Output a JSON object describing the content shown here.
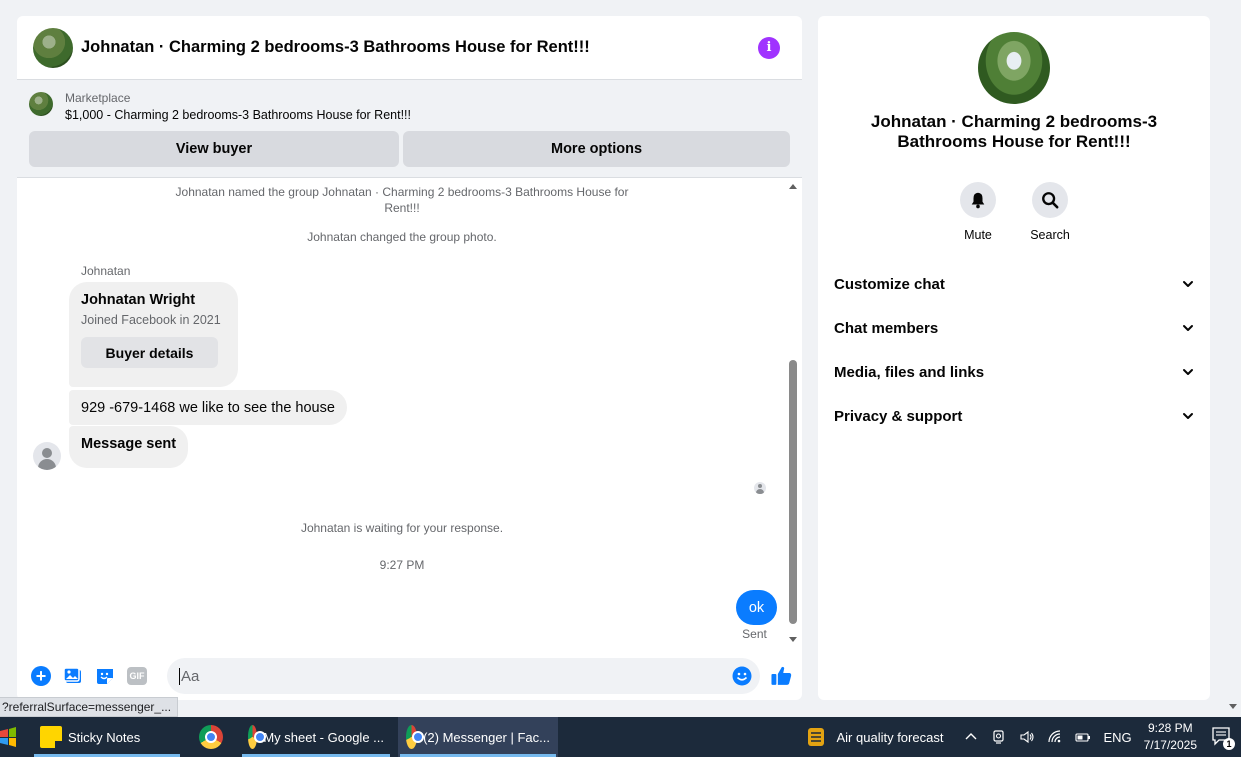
{
  "chat": {
    "title": "Johnatan · Charming 2 bedrooms-3 Bathrooms House for Rent!!!",
    "marketplace": {
      "label": "Marketplace",
      "item": "$1,000 - Charming 2 bedrooms-3 Bathrooms House for Rent!!!",
      "view_buyer": "View buyer",
      "more_options": "More options"
    },
    "system_messages": {
      "named_group": "Johnatan named the group Johnatan · Charming 2 bedrooms-3 Bathrooms House for Rent!!!",
      "changed_photo": "Johnatan changed the group photo.",
      "waiting": "Johnatan is waiting for your response.",
      "time": "9:27 PM"
    },
    "sender": "Johnatan",
    "buyer_card": {
      "name": "Johnatan Wright",
      "joined": "Joined Facebook in 2021",
      "button": "Buyer details"
    },
    "messages": [
      {
        "text": "929 -679-1468 we like to see the house"
      },
      {
        "text": "Message sent"
      }
    ],
    "my_message": {
      "text": "ok",
      "status": "Sent"
    },
    "composer": {
      "placeholder": "Aa",
      "gif": "GIF"
    }
  },
  "info_panel": {
    "title": "Johnatan · Charming 2 bedrooms-3 Bathrooms House for Rent!!!",
    "actions": [
      {
        "label": "Mute",
        "icon": "bell-icon"
      },
      {
        "label": "Search",
        "icon": "search-icon"
      }
    ],
    "sections": [
      {
        "label": "Customize chat"
      },
      {
        "label": "Chat members"
      },
      {
        "label": "Media, files and links"
      },
      {
        "label": "Privacy & support"
      }
    ]
  },
  "status_url": "?referralSurface=messenger_...",
  "taskbar": {
    "items": [
      {
        "label": "Sticky Notes"
      },
      {
        "label": ""
      },
      {
        "label": "My sheet - Google ..."
      },
      {
        "label": "(2) Messenger | Fac..."
      }
    ],
    "weather": "Air quality forecast",
    "language": "ENG",
    "time": "9:28 PM",
    "date": "7/17/2025",
    "notifications": "1"
  },
  "colors": {
    "accent": "#0a7cff",
    "info": "#a033ff",
    "taskbar": "#1c2a3b"
  }
}
